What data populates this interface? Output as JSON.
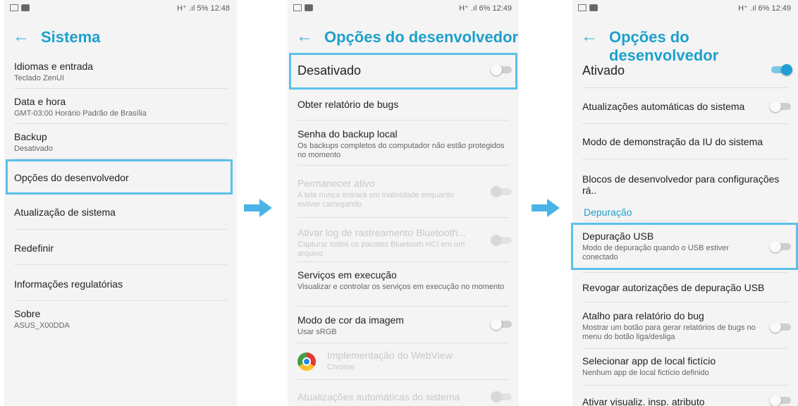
{
  "screen1": {
    "status": {
      "signal": "H⁺ .ıl 5%",
      "time": "12:48"
    },
    "title": "Sistema",
    "items": [
      {
        "title": "Idiomas e entrada",
        "subtitle": "Teclado ZenUI"
      },
      {
        "title": "Data e hora",
        "subtitle": "GMT-03:00 Horário Padrão de Brasília"
      },
      {
        "title": "Backup",
        "subtitle": "Desativado"
      },
      {
        "title": "Opções do desenvolvedor"
      },
      {
        "title": "Atualização de sistema"
      },
      {
        "title": "Redefinir"
      },
      {
        "title": "Informações regulatórias"
      },
      {
        "title": "Sobre",
        "subtitle": "ASUS_X00DDA"
      }
    ]
  },
  "screen2": {
    "status": {
      "signal": "H⁺ .ıl 6%",
      "time": "12:49"
    },
    "title": "Opções do desenvolvedor",
    "master": {
      "label": "Desativado",
      "on": false
    },
    "items": [
      {
        "title": "Obter relatório de bugs"
      },
      {
        "title": "Senha do backup local",
        "subtitle": "Os backups completos do computador não estão protegidos no momento"
      },
      {
        "title": "Permanecer ativo",
        "subtitle": "A tela nunca entrará em inatividade enquanto estiver carregando."
      },
      {
        "title": "Ativar log de rastreamento Bluetooth...",
        "subtitle": "Capturar todos os pacotes Bluetooth HCI em um arquivo"
      },
      {
        "title": "Serviços em execução",
        "subtitle": "Visualizar e controlar os serviços em execução no momento"
      },
      {
        "title": "Modo de cor da imagem",
        "subtitle": "Usar sRGB"
      },
      {
        "title": "Implementação do WebView",
        "subtitle": "Chrome"
      },
      {
        "title": "Atualizações automáticas do sistema"
      }
    ]
  },
  "screen3": {
    "status": {
      "signal": "H⁺ .ıl 6%",
      "time": "12:49"
    },
    "title": "Opções do desenvolvedor",
    "master": {
      "label": "Ativado",
      "on": true
    },
    "items": [
      {
        "title": "Atualizações automáticas do sistema"
      },
      {
        "title": "Modo de demonstração da IU do sistema"
      },
      {
        "title": "Blocos de desenvolvedor para configurações rá.."
      },
      {
        "title": "Depuração USB",
        "subtitle": "Modo de depuração quando o USB estiver conectado"
      },
      {
        "title": "Revogar autorizações de depuração USB"
      },
      {
        "title": "Atalho para relatório do bug",
        "subtitle": "Mostrar um botão para gerar relatórios de bugs no menu do botão liga/desliga"
      },
      {
        "title": "Selecionar app de local fictício",
        "subtitle": "Nenhum app de local fictício definido"
      },
      {
        "title": "Ativar visualiz. insp. atributo"
      }
    ],
    "category": "Depuração"
  },
  "colors": {
    "accent": "#1ea0cc",
    "highlight": "#5bc0ea",
    "arrow": "#4ab4e6"
  },
  "icons": {
    "back": "back-arrow-icon",
    "chrome": "chrome-icon"
  }
}
